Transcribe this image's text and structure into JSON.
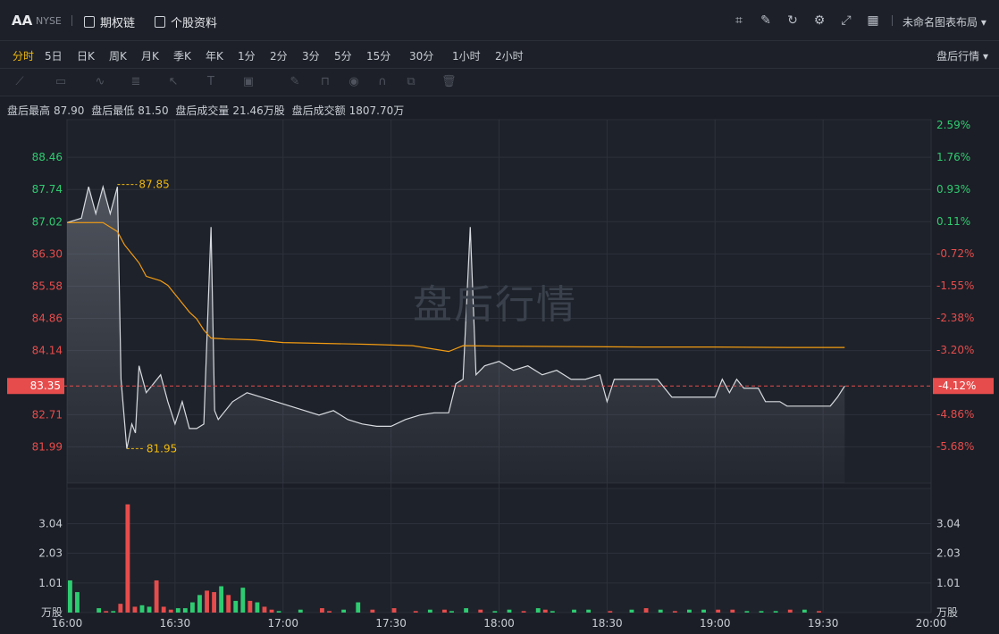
{
  "header": {
    "ticker": "AA",
    "exchange": "NYSE",
    "options_chain": "期权链",
    "profile": "个股资料",
    "layout_name": "未命名图表布局"
  },
  "periods": [
    "分时",
    "5日",
    "日K",
    "周K",
    "月K",
    "季K",
    "年K",
    "1分",
    "2分",
    "3分",
    "5分",
    "15分",
    "30分",
    "1小时",
    "2小时"
  ],
  "period_active": "分时",
  "session_selector": "盘后行情",
  "stats": {
    "high_label": "盘后最高",
    "high": "87.90",
    "low_label": "盘后最低",
    "low": "81.50",
    "vol_label": "盘后成交量",
    "vol": "21.46万股",
    "amt_label": "盘后成交额",
    "amt": "1807.70万"
  },
  "watermark": "盘后行情",
  "colors": {
    "up": "#e74c4c",
    "down": "#2ecc71",
    "price": "#d8dbe0",
    "avg": "#f39c12",
    "marker": "#f0b90b"
  },
  "chart_data": {
    "type": "line",
    "x_ticks": [
      "16:00",
      "16:30",
      "17:00",
      "17:30",
      "18:00",
      "18:30",
      "19:00",
      "19:30",
      "20:00"
    ],
    "price_ticks": [
      "88.46",
      "87.74",
      "87.02",
      "86.30",
      "85.58",
      "84.86",
      "84.14",
      "82.71",
      "81.99"
    ],
    "pct_ticks": [
      "2.59%",
      "1.76%",
      "0.93%",
      "0.11%",
      "-0.72%",
      "-1.55%",
      "-2.38%",
      "-3.20%",
      "-4.86%",
      "-5.68%"
    ],
    "current_price": "83.35",
    "current_pct": "-4.12%",
    "high_marker": "87.85",
    "low_marker": "81.95",
    "volume_ticks": [
      "3.04",
      "2.03",
      "1.01"
    ],
    "volume_unit": "万股",
    "ylim": [
      81.3,
      89.3
    ],
    "price_series": [
      [
        0,
        87.0
      ],
      [
        2,
        87.1
      ],
      [
        3,
        87.8
      ],
      [
        4,
        87.2
      ],
      [
        5,
        87.8
      ],
      [
        6,
        87.2
      ],
      [
        7,
        87.8
      ],
      [
        7.5,
        83.5
      ],
      [
        8.3,
        81.95
      ],
      [
        9,
        82.5
      ],
      [
        9.5,
        82.3
      ],
      [
        10,
        83.8
      ],
      [
        11,
        83.2
      ],
      [
        12,
        83.4
      ],
      [
        13,
        83.6
      ],
      [
        14,
        83.0
      ],
      [
        15,
        82.5
      ],
      [
        16,
        83.0
      ],
      [
        17,
        82.4
      ],
      [
        18,
        82.4
      ],
      [
        19,
        82.5
      ],
      [
        20,
        86.9
      ],
      [
        20.5,
        82.8
      ],
      [
        21,
        82.6
      ],
      [
        23,
        83.0
      ],
      [
        25,
        83.2
      ],
      [
        27,
        83.1
      ],
      [
        29,
        83.0
      ],
      [
        31,
        82.9
      ],
      [
        33,
        82.8
      ],
      [
        35,
        82.7
      ],
      [
        37,
        82.8
      ],
      [
        39,
        82.6
      ],
      [
        41,
        82.5
      ],
      [
        43,
        82.45
      ],
      [
        45,
        82.45
      ],
      [
        47,
        82.6
      ],
      [
        49,
        82.7
      ],
      [
        51,
        82.75
      ],
      [
        53,
        82.75
      ],
      [
        54,
        83.4
      ],
      [
        55,
        83.5
      ],
      [
        56,
        86.9
      ],
      [
        56.8,
        83.6
      ],
      [
        58,
        83.8
      ],
      [
        60,
        83.9
      ],
      [
        62,
        83.7
      ],
      [
        64,
        83.8
      ],
      [
        66,
        83.6
      ],
      [
        68,
        83.7
      ],
      [
        70,
        83.5
      ],
      [
        72,
        83.5
      ],
      [
        74,
        83.6
      ],
      [
        75,
        83.0
      ],
      [
        76,
        83.5
      ],
      [
        78,
        83.5
      ],
      [
        80,
        83.5
      ],
      [
        82,
        83.5
      ],
      [
        84,
        83.1
      ],
      [
        86,
        83.1
      ],
      [
        88,
        83.1
      ],
      [
        90,
        83.1
      ],
      [
        91,
        83.5
      ],
      [
        92,
        83.2
      ],
      [
        93,
        83.5
      ],
      [
        94,
        83.3
      ],
      [
        96,
        83.3
      ],
      [
        97,
        83.0
      ],
      [
        99,
        83.0
      ],
      [
        100,
        82.9
      ],
      [
        102,
        82.9
      ],
      [
        104,
        82.9
      ],
      [
        106,
        82.9
      ],
      [
        107,
        83.1
      ],
      [
        108,
        83.35
      ]
    ],
    "avg_series": [
      [
        0,
        87.0
      ],
      [
        5,
        87.0
      ],
      [
        7,
        86.8
      ],
      [
        8,
        86.5
      ],
      [
        9,
        86.3
      ],
      [
        10,
        86.1
      ],
      [
        11,
        85.8
      ],
      [
        12,
        85.75
      ],
      [
        13,
        85.7
      ],
      [
        14,
        85.6
      ],
      [
        15,
        85.4
      ],
      [
        16,
        85.2
      ],
      [
        17,
        85.0
      ],
      [
        18,
        84.85
      ],
      [
        19,
        84.6
      ],
      [
        20,
        84.42
      ],
      [
        22,
        84.4
      ],
      [
        26,
        84.38
      ],
      [
        30,
        84.32
      ],
      [
        36,
        84.3
      ],
      [
        42,
        84.28
      ],
      [
        48,
        84.25
      ],
      [
        53,
        84.12
      ],
      [
        55,
        84.25
      ],
      [
        60,
        84.24
      ],
      [
        70,
        84.23
      ],
      [
        80,
        84.22
      ],
      [
        90,
        84.22
      ],
      [
        100,
        84.21
      ],
      [
        108,
        84.21
      ]
    ],
    "volume_bars": [
      [
        0,
        1.1,
        "down"
      ],
      [
        1,
        0.7,
        "down"
      ],
      [
        4,
        0.15,
        "down"
      ],
      [
        5,
        0.05,
        "up"
      ],
      [
        6,
        0.05,
        "down"
      ],
      [
        7,
        0.3,
        "up"
      ],
      [
        8,
        3.7,
        "up"
      ],
      [
        9,
        0.2,
        "up"
      ],
      [
        10,
        0.25,
        "down"
      ],
      [
        11,
        0.2,
        "down"
      ],
      [
        12,
        1.1,
        "up"
      ],
      [
        13,
        0.2,
        "up"
      ],
      [
        14,
        0.1,
        "up"
      ],
      [
        15,
        0.15,
        "down"
      ],
      [
        16,
        0.15,
        "down"
      ],
      [
        17,
        0.35,
        "down"
      ],
      [
        18,
        0.6,
        "down"
      ],
      [
        19,
        0.75,
        "up"
      ],
      [
        20,
        0.7,
        "up"
      ],
      [
        21,
        0.9,
        "down"
      ],
      [
        22,
        0.6,
        "up"
      ],
      [
        23,
        0.4,
        "down"
      ],
      [
        24,
        0.85,
        "down"
      ],
      [
        25,
        0.4,
        "up"
      ],
      [
        26,
        0.35,
        "down"
      ],
      [
        27,
        0.2,
        "up"
      ],
      [
        28,
        0.1,
        "up"
      ],
      [
        29,
        0.05,
        "down"
      ],
      [
        32,
        0.1,
        "down"
      ],
      [
        35,
        0.15,
        "up"
      ],
      [
        36,
        0.05,
        "up"
      ],
      [
        38,
        0.1,
        "down"
      ],
      [
        40,
        0.35,
        "down"
      ],
      [
        42,
        0.1,
        "up"
      ],
      [
        45,
        0.15,
        "up"
      ],
      [
        48,
        0.05,
        "up"
      ],
      [
        50,
        0.1,
        "down"
      ],
      [
        52,
        0.1,
        "up"
      ],
      [
        53,
        0.05,
        "down"
      ],
      [
        55,
        0.15,
        "down"
      ],
      [
        57,
        0.1,
        "up"
      ],
      [
        59,
        0.05,
        "down"
      ],
      [
        61,
        0.1,
        "down"
      ],
      [
        63,
        0.05,
        "up"
      ],
      [
        65,
        0.15,
        "down"
      ],
      [
        66,
        0.1,
        "up"
      ],
      [
        67,
        0.05,
        "down"
      ],
      [
        70,
        0.1,
        "down"
      ],
      [
        72,
        0.1,
        "down"
      ],
      [
        75,
        0.05,
        "up"
      ],
      [
        78,
        0.1,
        "down"
      ],
      [
        80,
        0.15,
        "up"
      ],
      [
        82,
        0.1,
        "down"
      ],
      [
        84,
        0.05,
        "up"
      ],
      [
        86,
        0.1,
        "down"
      ],
      [
        88,
        0.1,
        "down"
      ],
      [
        90,
        0.1,
        "up"
      ],
      [
        92,
        0.1,
        "up"
      ],
      [
        94,
        0.05,
        "down"
      ],
      [
        96,
        0.05,
        "down"
      ],
      [
        98,
        0.05,
        "down"
      ],
      [
        100,
        0.1,
        "up"
      ],
      [
        102,
        0.1,
        "down"
      ],
      [
        104,
        0.05,
        "up"
      ]
    ],
    "volume_ylim": [
      0,
      4.0
    ]
  }
}
